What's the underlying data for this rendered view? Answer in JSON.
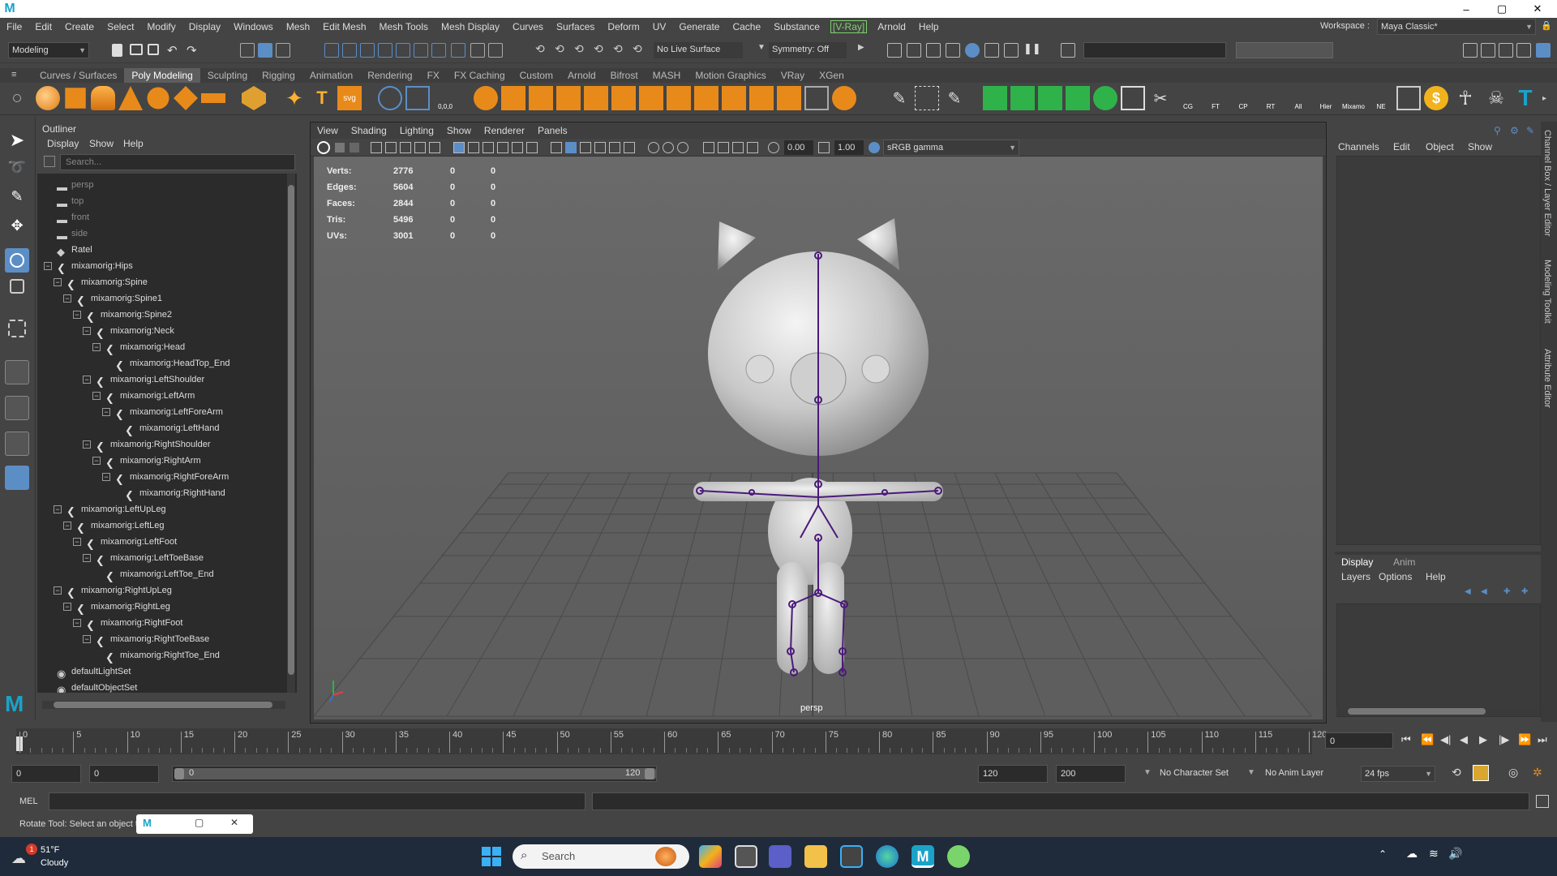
{
  "titlebar": {
    "minimize": "–",
    "maximize": "▢",
    "close": "✕"
  },
  "menubar": [
    "File",
    "Edit",
    "Create",
    "Select",
    "Modify",
    "Display",
    "Windows",
    "Mesh",
    "Edit Mesh",
    "Mesh Tools",
    "Mesh Display",
    "Curves",
    "Surfaces",
    "Deform",
    "UV",
    "Generate",
    "Cache",
    "Substance",
    "[V-Ray]",
    "Arnold",
    "Help"
  ],
  "workspace": {
    "label": "Workspace :",
    "value": "Maya Classic*"
  },
  "statusline": {
    "menuset": "Modeling",
    "live_surface": "No Live Surface",
    "symmetry": "Symmetry: Off"
  },
  "shelf_tabs": [
    "Curves / Surfaces",
    "Poly Modeling",
    "Sculpting",
    "Rigging",
    "Animation",
    "Rendering",
    "FX",
    "FX Caching",
    "Custom",
    "Arnold",
    "Bifrost",
    "MASH",
    "Motion Graphics",
    "VRay",
    "XGen"
  ],
  "shelf_active": "Poly Modeling",
  "shelf_icon_labels": {
    "svg": "svg",
    "text": "T",
    "cg": "CG",
    "ft": "FT",
    "cp": "CP",
    "rt": "RT",
    "all": "All",
    "hier": "Hier",
    "mixamo": "Mixamo",
    "ne": "NE",
    "dollar": "$",
    "coords": "0,0,0"
  },
  "outliner": {
    "title": "Outliner",
    "menus": [
      "Display",
      "Show",
      "Help"
    ],
    "search_placeholder": "Search...",
    "items": [
      {
        "label": "persp",
        "depth": 0,
        "icon": "camera-icon",
        "dim": true,
        "expander": ""
      },
      {
        "label": "top",
        "depth": 0,
        "icon": "camera-icon",
        "dim": true,
        "expander": ""
      },
      {
        "label": "front",
        "depth": 0,
        "icon": "camera-icon",
        "dim": true,
        "expander": ""
      },
      {
        "label": "side",
        "depth": 0,
        "icon": "camera-icon",
        "dim": true,
        "expander": ""
      },
      {
        "label": "Ratel",
        "depth": 0,
        "icon": "mesh-icon",
        "dim": false,
        "expander": ""
      },
      {
        "label": "mixamorig:Hips",
        "depth": 0,
        "icon": "joint-icon",
        "dim": false,
        "expander": "−"
      },
      {
        "label": "mixamorig:Spine",
        "depth": 1,
        "icon": "joint-icon",
        "dim": false,
        "expander": "−"
      },
      {
        "label": "mixamorig:Spine1",
        "depth": 2,
        "icon": "joint-icon",
        "dim": false,
        "expander": "−"
      },
      {
        "label": "mixamorig:Spine2",
        "depth": 3,
        "icon": "joint-icon",
        "dim": false,
        "expander": "−"
      },
      {
        "label": "mixamorig:Neck",
        "depth": 4,
        "icon": "joint-icon",
        "dim": false,
        "expander": "−"
      },
      {
        "label": "mixamorig:Head",
        "depth": 5,
        "icon": "joint-icon",
        "dim": false,
        "expander": "−"
      },
      {
        "label": "mixamorig:HeadTop_End",
        "depth": 6,
        "icon": "joint-icon",
        "dim": false,
        "expander": ""
      },
      {
        "label": "mixamorig:LeftShoulder",
        "depth": 4,
        "icon": "joint-icon",
        "dim": false,
        "expander": "−"
      },
      {
        "label": "mixamorig:LeftArm",
        "depth": 5,
        "icon": "joint-icon",
        "dim": false,
        "expander": "−"
      },
      {
        "label": "mixamorig:LeftForeArm",
        "depth": 6,
        "icon": "joint-icon",
        "dim": false,
        "expander": "−"
      },
      {
        "label": "mixamorig:LeftHand",
        "depth": 7,
        "icon": "joint-icon",
        "dim": false,
        "expander": ""
      },
      {
        "label": "mixamorig:RightShoulder",
        "depth": 4,
        "icon": "joint-icon",
        "dim": false,
        "expander": "−"
      },
      {
        "label": "mixamorig:RightArm",
        "depth": 5,
        "icon": "joint-icon",
        "dim": false,
        "expander": "−"
      },
      {
        "label": "mixamorig:RightForeArm",
        "depth": 6,
        "icon": "joint-icon",
        "dim": false,
        "expander": "−"
      },
      {
        "label": "mixamorig:RightHand",
        "depth": 7,
        "icon": "joint-icon",
        "dim": false,
        "expander": ""
      },
      {
        "label": "mixamorig:LeftUpLeg",
        "depth": 1,
        "icon": "joint-icon",
        "dim": false,
        "expander": "−"
      },
      {
        "label": "mixamorig:LeftLeg",
        "depth": 2,
        "icon": "joint-icon",
        "dim": false,
        "expander": "−"
      },
      {
        "label": "mixamorig:LeftFoot",
        "depth": 3,
        "icon": "joint-icon",
        "dim": false,
        "expander": "−"
      },
      {
        "label": "mixamorig:LeftToeBase",
        "depth": 4,
        "icon": "joint-icon",
        "dim": false,
        "expander": "−"
      },
      {
        "label": "mixamorig:LeftToe_End",
        "depth": 5,
        "icon": "joint-icon",
        "dim": false,
        "expander": ""
      },
      {
        "label": "mixamorig:RightUpLeg",
        "depth": 1,
        "icon": "joint-icon",
        "dim": false,
        "expander": "−"
      },
      {
        "label": "mixamorig:RightLeg",
        "depth": 2,
        "icon": "joint-icon",
        "dim": false,
        "expander": "−"
      },
      {
        "label": "mixamorig:RightFoot",
        "depth": 3,
        "icon": "joint-icon",
        "dim": false,
        "expander": "−"
      },
      {
        "label": "mixamorig:RightToeBase",
        "depth": 4,
        "icon": "joint-icon",
        "dim": false,
        "expander": "−"
      },
      {
        "label": "mixamorig:RightToe_End",
        "depth": 5,
        "icon": "joint-icon",
        "dim": false,
        "expander": ""
      },
      {
        "label": "defaultLightSet",
        "depth": 0,
        "icon": "set-icon",
        "dim": false,
        "expander": ""
      },
      {
        "label": "defaultObjectSet",
        "depth": 0,
        "icon": "set-icon",
        "dim": false,
        "expander": ""
      }
    ]
  },
  "viewport": {
    "menus": [
      "View",
      "Shading",
      "Lighting",
      "Show",
      "Renderer",
      "Panels"
    ],
    "near_value": "0.00",
    "exposure_value": "1.00",
    "color_space": "sRGB gamma",
    "camera_label": "persp",
    "hud": [
      {
        "label": "Verts:",
        "a": "2776",
        "b": "0",
        "c": "0"
      },
      {
        "label": "Edges:",
        "a": "5604",
        "b": "0",
        "c": "0"
      },
      {
        "label": "Faces:",
        "a": "2844",
        "b": "0",
        "c": "0"
      },
      {
        "label": "Tris:",
        "a": "5496",
        "b": "0",
        "c": "0"
      },
      {
        "label": "UVs:",
        "a": "3001",
        "b": "0",
        "c": "0"
      }
    ]
  },
  "channelbox": {
    "menus": [
      "Channels",
      "Edit",
      "Object",
      "Show"
    ],
    "layer_tabs": [
      "Display",
      "Anim"
    ],
    "layer_menus": [
      "Layers",
      "Options",
      "Help"
    ],
    "side_tabs": [
      "Channel Box / Layer Editor",
      "Modeling Toolkit",
      "Attribute Editor"
    ]
  },
  "timeslider": {
    "ticks": [
      "0",
      "5",
      "10",
      "15",
      "20",
      "25",
      "30",
      "35",
      "40",
      "45",
      "50",
      "55",
      "60",
      "65",
      "70",
      "75",
      "80",
      "85",
      "90",
      "95",
      "100",
      "105",
      "110",
      "115",
      "120"
    ],
    "current_frame": "0"
  },
  "rangeslider": {
    "start": "0",
    "playback_start": "0",
    "range_start_label": "0",
    "range_end_label": "120",
    "playback_end": "120",
    "end": "200",
    "character_set": "No Character Set",
    "anim_layer": "No Anim Layer",
    "fps": "24 fps"
  },
  "cmdline": {
    "label": "MEL"
  },
  "helpline": {
    "text": "Rotate Tool: Select an object to r"
  },
  "taskbar": {
    "weather_temp": "51°F",
    "weather_desc": "Cloudy",
    "weather_badge": "1",
    "search_placeholder": "Search"
  },
  "colors": {
    "accent": "#5c8ec6",
    "joint": "#5a2a8a",
    "vray": "#7bd36b",
    "maya": "#1aa3c9"
  }
}
